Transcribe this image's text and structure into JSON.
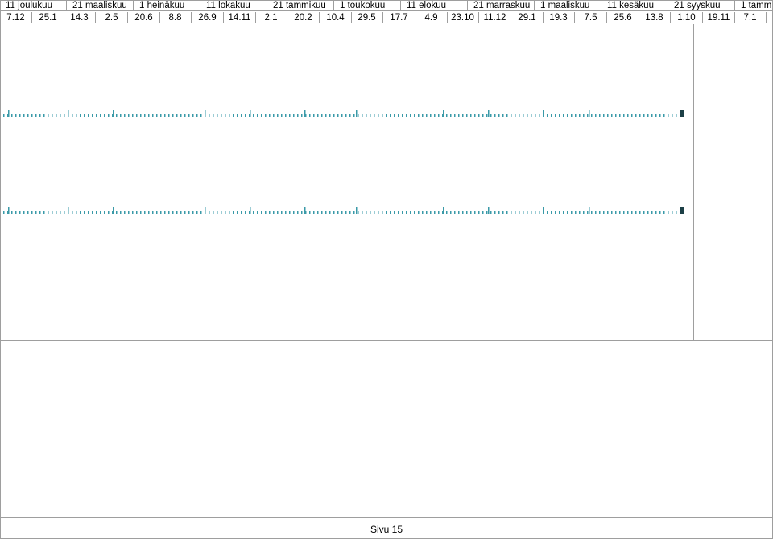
{
  "timeline": {
    "months": [
      "11 joulukuu",
      "21 maaliskuu",
      "1 heinäkuu",
      "11 lokakuu",
      "21 tammikuu",
      "1 toukokuu",
      "11 elokuu",
      "21 marraskuu",
      "1 maaliskuu",
      "11 kesäkuu",
      "21 syyskuu",
      "1 tammik"
    ],
    "dates": [
      "7.12",
      "25.1",
      "14.3",
      "2.5",
      "20.6",
      "8.8",
      "26.9",
      "14.11",
      "2.1",
      "20.2",
      "10.4",
      "29.5",
      "17.7",
      "4.9",
      "23.10",
      "11.12",
      "29.1",
      "19.3",
      "7.5",
      "25.6",
      "13.8",
      "1.10",
      "19.11",
      "7.1"
    ],
    "tick_color": "#3a9aa8",
    "end_marker_color": "#1c3f46"
  },
  "footer": {
    "page_label": "Sivu 15"
  }
}
